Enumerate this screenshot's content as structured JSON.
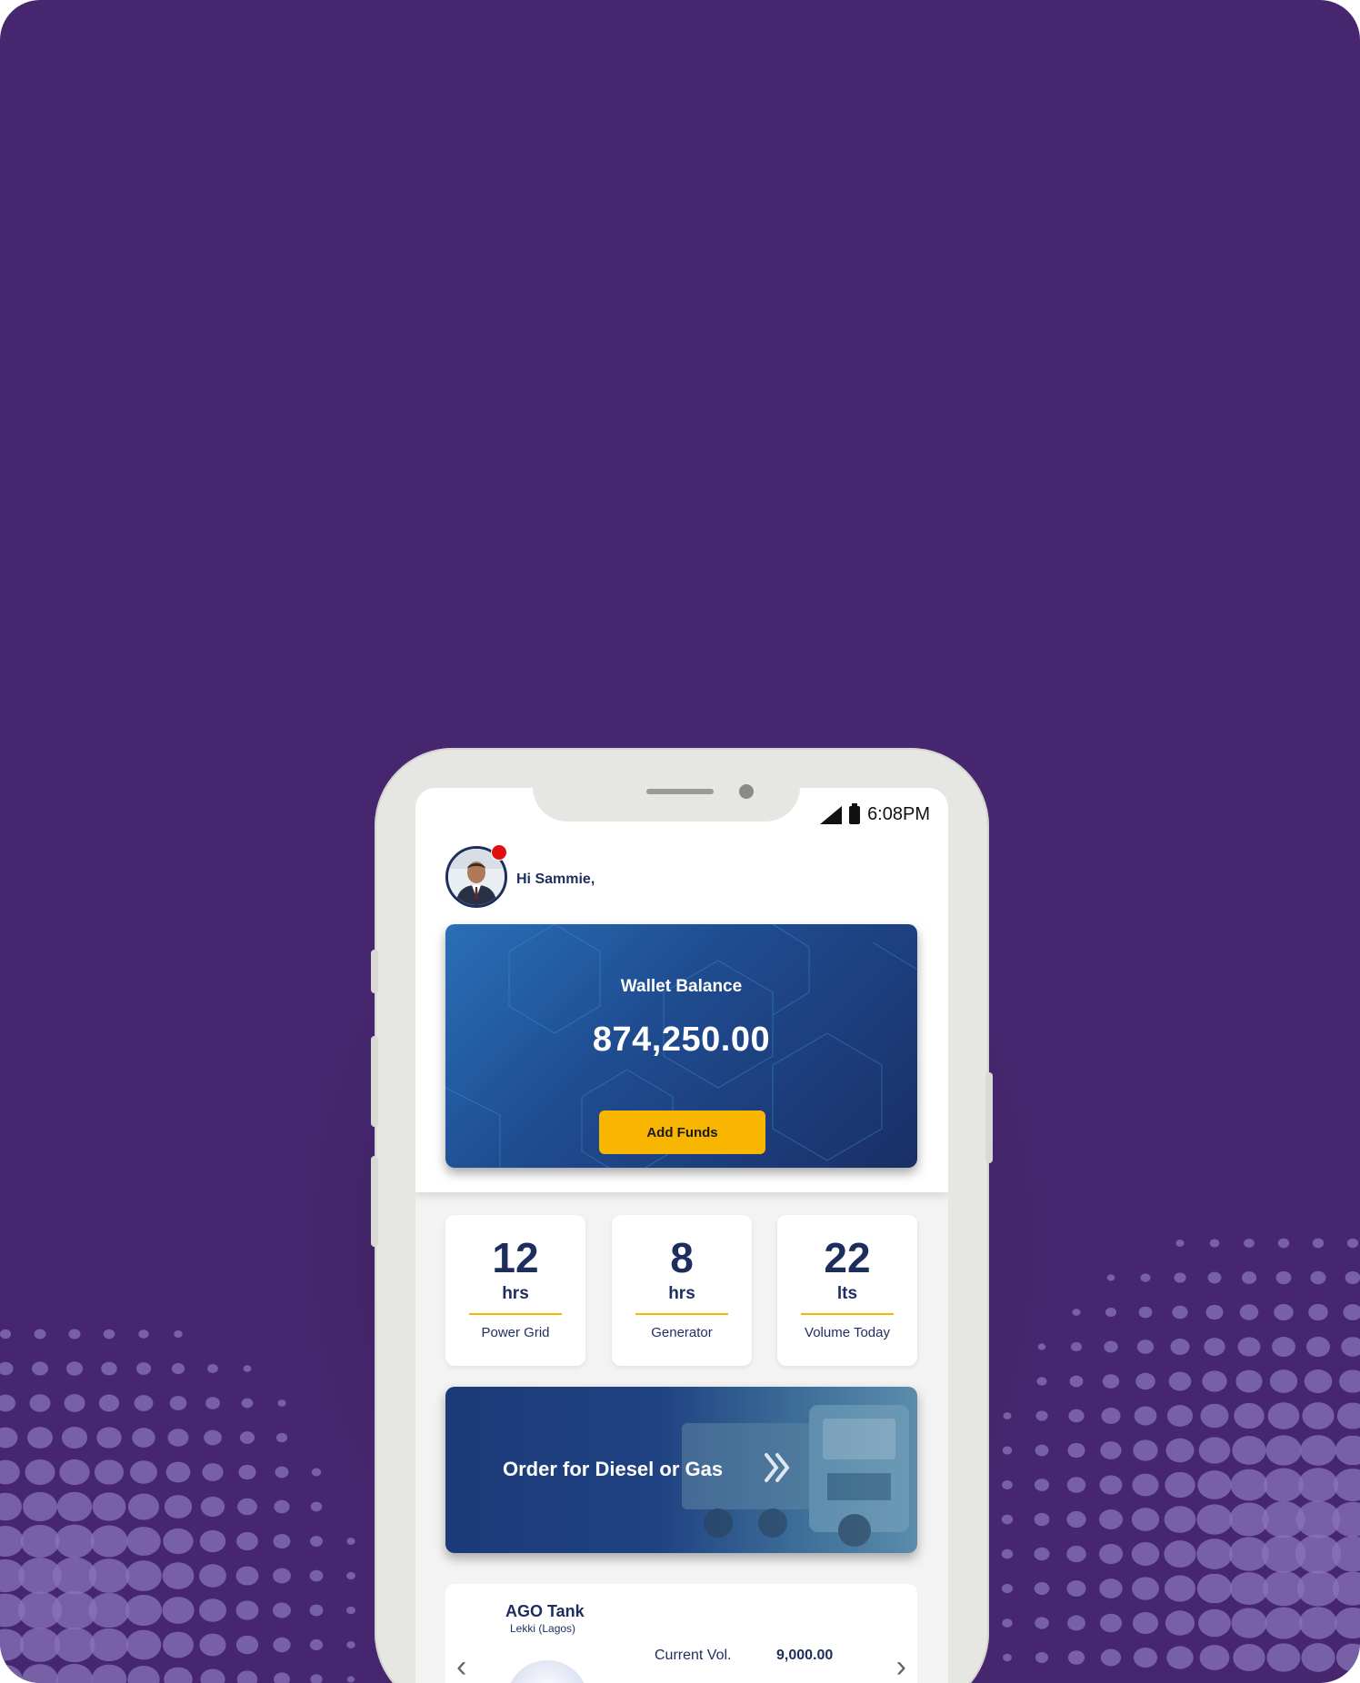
{
  "status_bar": {
    "time": "6:08PM"
  },
  "header": {
    "greeting": "Hi Sammie,"
  },
  "wallet": {
    "title": "Wallet Balance",
    "amount": "874,250.00",
    "add_funds_label": "Add Funds"
  },
  "stats": [
    {
      "value": "12",
      "unit": "hrs",
      "label": "Power Grid"
    },
    {
      "value": "8",
      "unit": "hrs",
      "label": "Generator"
    },
    {
      "value": "22",
      "unit": "lts",
      "label": "Volume Today"
    }
  ],
  "order_banner": {
    "label": "Order for Diesel or Gas"
  },
  "tank": {
    "title": "AGO Tank",
    "location": "Lekki (Lagos)",
    "current_vol_label": "Current Vol.",
    "current_vol_value": "9,000.00"
  },
  "icons": {
    "signal": "signal-icon",
    "battery": "battery-icon",
    "chevron": "double-chevron-right-icon",
    "prev": "chevron-left-icon",
    "next": "chevron-right-icon"
  },
  "colors": {
    "background": "#46276f",
    "accent": "#f9b600",
    "navy": "#1d2e5e",
    "notification": "#e01010"
  }
}
